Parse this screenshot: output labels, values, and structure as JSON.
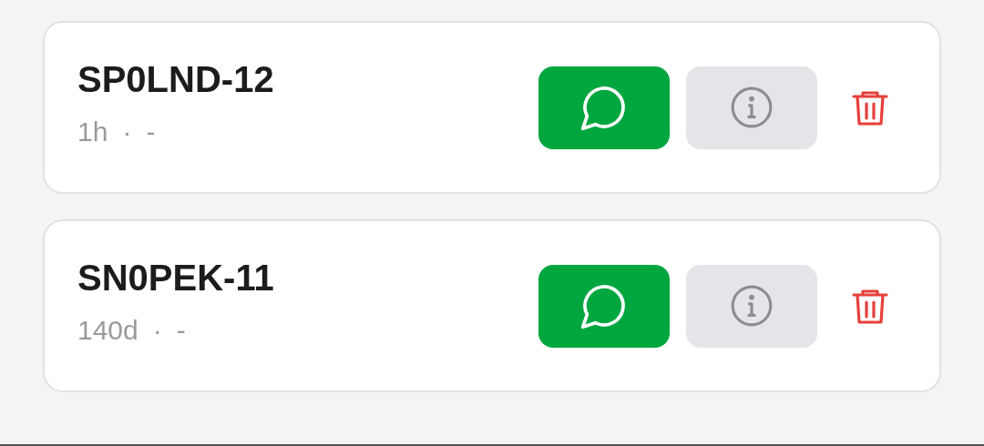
{
  "stations": [
    {
      "callsign": "SP0LND-12",
      "age": "1h",
      "separator": "·",
      "detail": "-"
    },
    {
      "callsign": "SN0PEK-11",
      "age": "140d",
      "separator": "·",
      "detail": "-"
    }
  ]
}
